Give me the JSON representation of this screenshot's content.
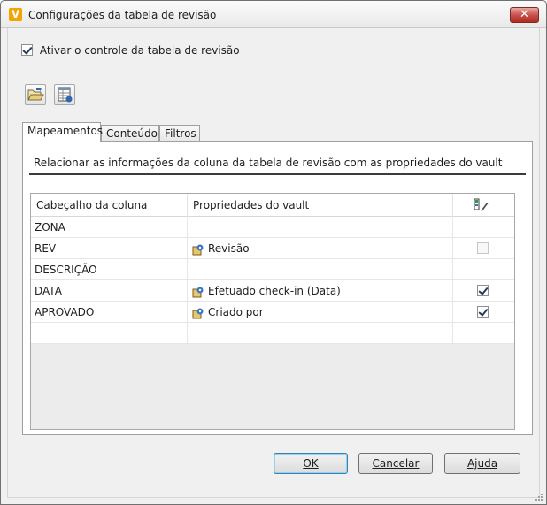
{
  "window": {
    "title": "Configurações da tabela de revisão",
    "app_icon_letter": "V",
    "close_glyph": "✕"
  },
  "enable_checkbox": {
    "label": "Ativar o controle da tabela de revisão",
    "checked": true
  },
  "toolbar": {
    "icons": [
      "open-folder-icon",
      "table-settings-icon"
    ]
  },
  "tabs": [
    {
      "label": "Mapeamentos",
      "active": true
    },
    {
      "label": "Conteúdo",
      "active": false
    },
    {
      "label": "Filtros",
      "active": false
    }
  ],
  "mapping": {
    "description": "Relacionar as informações da coluna da tabela de revisão com as propriedades do vault",
    "columns": {
      "header": "Cabeçalho da coluna",
      "property": "Propriedades do vault",
      "edit_icon": "edit-column-icon"
    },
    "rows": [
      {
        "header": "ZONA",
        "property": "",
        "checked": false,
        "checkbox_visible": false
      },
      {
        "header": "REV",
        "property": "Revisão",
        "checked": false,
        "checkbox_visible": true,
        "checkbox_disabled": true
      },
      {
        "header": "DESCRIÇÃO",
        "property": "",
        "checked": false,
        "checkbox_visible": false
      },
      {
        "header": "DATA",
        "property": "Efetuado check-in (Data)",
        "checked": true,
        "checkbox_visible": true
      },
      {
        "header": "APROVADO",
        "property": "Criado por",
        "checked": true,
        "checkbox_visible": true
      },
      {
        "header": "",
        "property": "",
        "checked": false,
        "checkbox_visible": false
      }
    ]
  },
  "buttons": {
    "ok": "OK",
    "cancel": "Cancelar",
    "help": "Ajuda"
  },
  "colors": {
    "accent": "#f4a300",
    "close_red": "#c75050",
    "default_button_border": "#3c7fb1"
  }
}
